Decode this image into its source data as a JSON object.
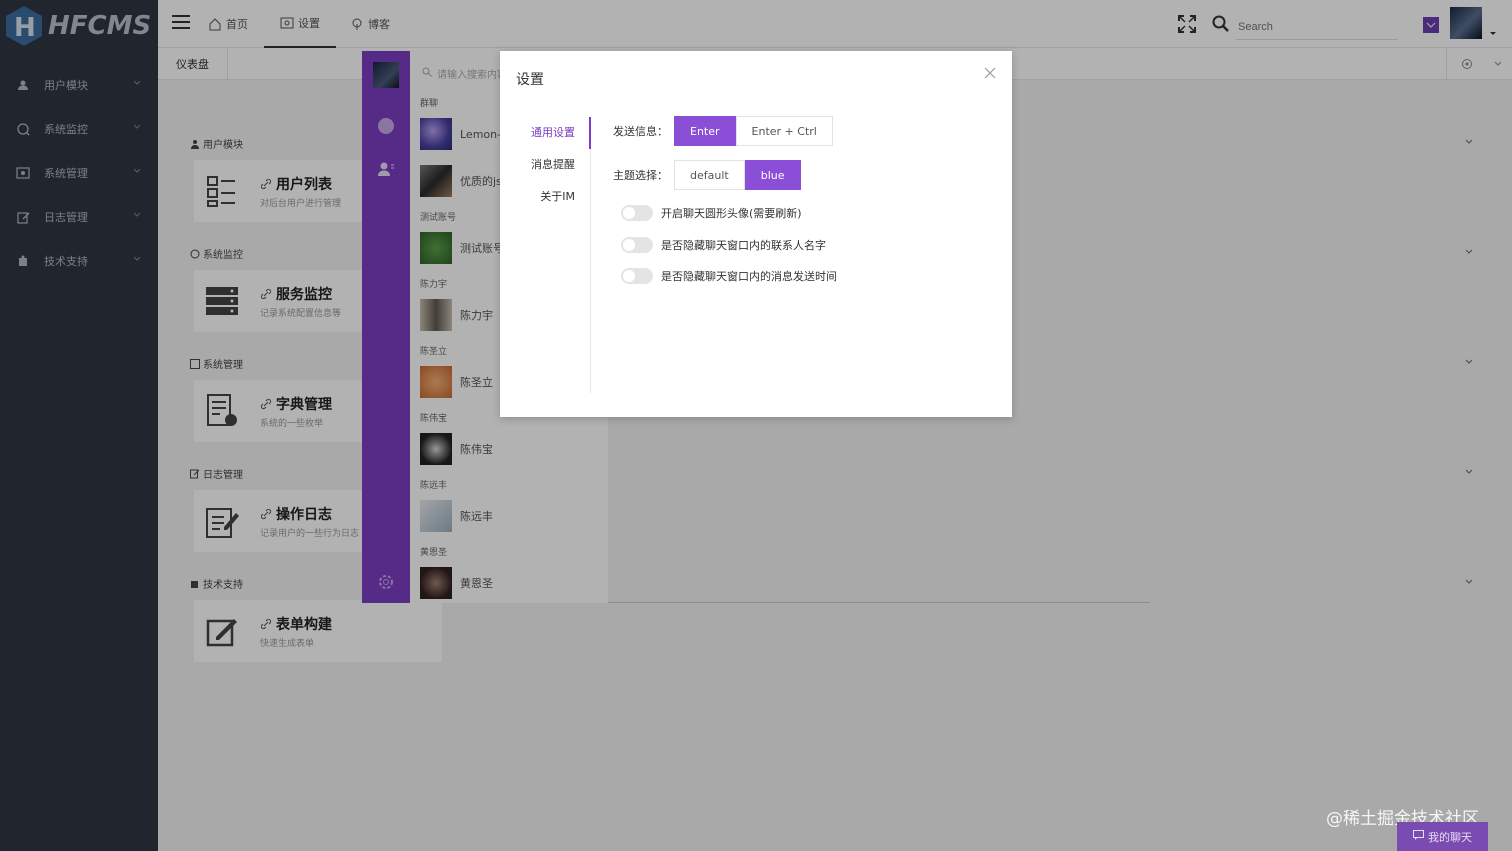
{
  "brand": {
    "name": "HFCMS"
  },
  "sidebar": {
    "items": [
      {
        "label": "用户模块",
        "icon": "user-icon"
      },
      {
        "label": "系统监控",
        "icon": "monitor-icon"
      },
      {
        "label": "系统管理",
        "icon": "system-icon"
      },
      {
        "label": "日志管理",
        "icon": "edit-icon"
      },
      {
        "label": "技术支持",
        "icon": "support-icon"
      }
    ]
  },
  "header": {
    "nav": [
      {
        "label": "首页",
        "icon": "home-icon"
      },
      {
        "label": "设置",
        "icon": "settings-icon"
      },
      {
        "label": "博客",
        "icon": "podcast-icon"
      }
    ],
    "search_placeholder": "Search"
  },
  "tabs": {
    "home": "仪表盘"
  },
  "content": {
    "sections": [
      {
        "title": "用户模块",
        "card_title": "用户列表",
        "card_desc": "对后台用户进行管理"
      },
      {
        "title": "系统监控",
        "card_title": "服务监控",
        "card_desc": "记录系统配置信息等"
      },
      {
        "title": "系统管理",
        "card_title": "字典管理",
        "card_desc": "系统的一些枚举"
      },
      {
        "title": "日志管理",
        "card_title": "操作日志",
        "card_desc": "记录用户的一些行为日志"
      },
      {
        "title": "技术支持",
        "card_title": "表单构建",
        "card_desc": "快速生成表单"
      }
    ]
  },
  "chat": {
    "search_placeholder": "请输入搜索内容",
    "groups": [
      {
        "label": "群聊",
        "contacts": [
          "Lemon-",
          "优质的js"
        ]
      },
      {
        "label": "测试账号",
        "contacts": [
          "测试账号"
        ]
      },
      {
        "label": "陈力宇",
        "contacts": [
          "陈力宇"
        ]
      },
      {
        "label": "陈圣立",
        "contacts": [
          "陈圣立"
        ]
      },
      {
        "label": "陈伟宝",
        "contacts": [
          "陈伟宝"
        ]
      },
      {
        "label": "陈远丰",
        "contacts": [
          "陈远丰"
        ]
      },
      {
        "label": "黄恩圣",
        "contacts": [
          "黄恩圣"
        ]
      }
    ]
  },
  "modal": {
    "title": "设置",
    "nav": [
      "通用设置",
      "消息提醒",
      "关于IM"
    ],
    "send_label": "发送信息：",
    "send_options": [
      "Enter",
      "Enter + Ctrl"
    ],
    "send_selected": "Enter",
    "theme_label": "主题选择：",
    "theme_options": [
      "default",
      "blue"
    ],
    "theme_selected": "blue",
    "toggles": [
      {
        "label": "开启聊天圆形头像(需要刷新)",
        "on": false
      },
      {
        "label": "是否隐藏聊天窗口内的联系人名字",
        "on": false
      },
      {
        "label": "是否隐藏聊天窗口内的消息发送时间",
        "on": false
      }
    ]
  },
  "footer": {
    "watermark": "@稀土掘金技术社区",
    "my_chat": "我的聊天"
  },
  "colors": {
    "sidebar_bg": "#2f3542",
    "accent": "#8a4fd6",
    "chat_bar": "#7a3ec2"
  }
}
